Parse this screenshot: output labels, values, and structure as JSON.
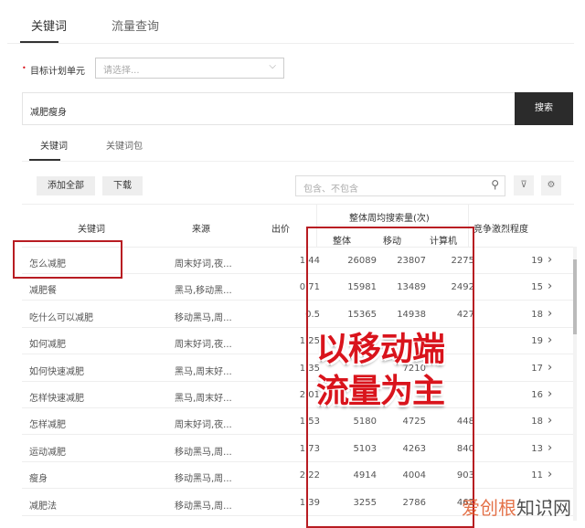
{
  "top_tabs": [
    "关键词",
    "流量查询"
  ],
  "target_unit": {
    "label": "目标计划单元",
    "placeholder": "请选择..."
  },
  "search": {
    "value": "减肥瘦身",
    "button": "搜索"
  },
  "sub_tabs": [
    "关键词",
    "关键词包"
  ],
  "toolbar": {
    "add_all": "添加全部",
    "download": "下载",
    "filter_placeholder": "包含、不包含"
  },
  "table": {
    "headers": {
      "keyword": "关键词",
      "source": "来源",
      "bid": "出价",
      "weekly_group": "整体周均搜索量(次)",
      "overall": "整体",
      "mobile": "移动",
      "pc": "计算机",
      "competition": "竞争激烈程度"
    },
    "rows": [
      {
        "keyword": "怎么减肥",
        "source": "周末好词,夜...",
        "bid": "1.44",
        "overall": "26089",
        "mobile": "23807",
        "pc": "2275",
        "competition": "19"
      },
      {
        "keyword": "减肥餐",
        "source": "黑马,移动黑...",
        "bid": "0.71",
        "overall": "15981",
        "mobile": "13489",
        "pc": "2492",
        "competition": "15"
      },
      {
        "keyword": "吃什么可以减肥",
        "source": "移动黑马,周...",
        "bid": "0.5",
        "overall": "15365",
        "mobile": "14938",
        "pc": "427",
        "competition": "18"
      },
      {
        "keyword": "如何减肥",
        "source": "周末好词,夜...",
        "bid": "1.25",
        "overall": "",
        "mobile": "",
        "pc": "",
        "competition": "19"
      },
      {
        "keyword": "如何快速减肥",
        "source": "黑马,周末好...",
        "bid": "1.35",
        "overall": "",
        "mobile": "7210",
        "pc": "",
        "competition": "17"
      },
      {
        "keyword": "怎样快速减肥",
        "source": "黑马,周末好...",
        "bid": "2.01",
        "overall": "",
        "mobile": "",
        "pc": "",
        "competition": "16"
      },
      {
        "keyword": "怎样减肥",
        "source": "周末好词,夜...",
        "bid": "1.53",
        "overall": "5180",
        "mobile": "4725",
        "pc": "448",
        "competition": "18"
      },
      {
        "keyword": "运动减肥",
        "source": "移动黑马,周...",
        "bid": "1.73",
        "overall": "5103",
        "mobile": "4263",
        "pc": "840",
        "competition": "13"
      },
      {
        "keyword": "瘦身",
        "source": "移动黑马,周...",
        "bid": "2.22",
        "overall": "4914",
        "mobile": "4004",
        "pc": "903",
        "competition": "11"
      },
      {
        "keyword": "减肥法",
        "source": "移动黑马,周...",
        "bid": "1.39",
        "overall": "3255",
        "mobile": "2786",
        "pc": "462",
        "competition": ""
      }
    ]
  },
  "annotation": {
    "line1": "以移动端",
    "line2": "流量为主",
    "color": "#d9141c"
  },
  "watermark": "爱创根知识网"
}
